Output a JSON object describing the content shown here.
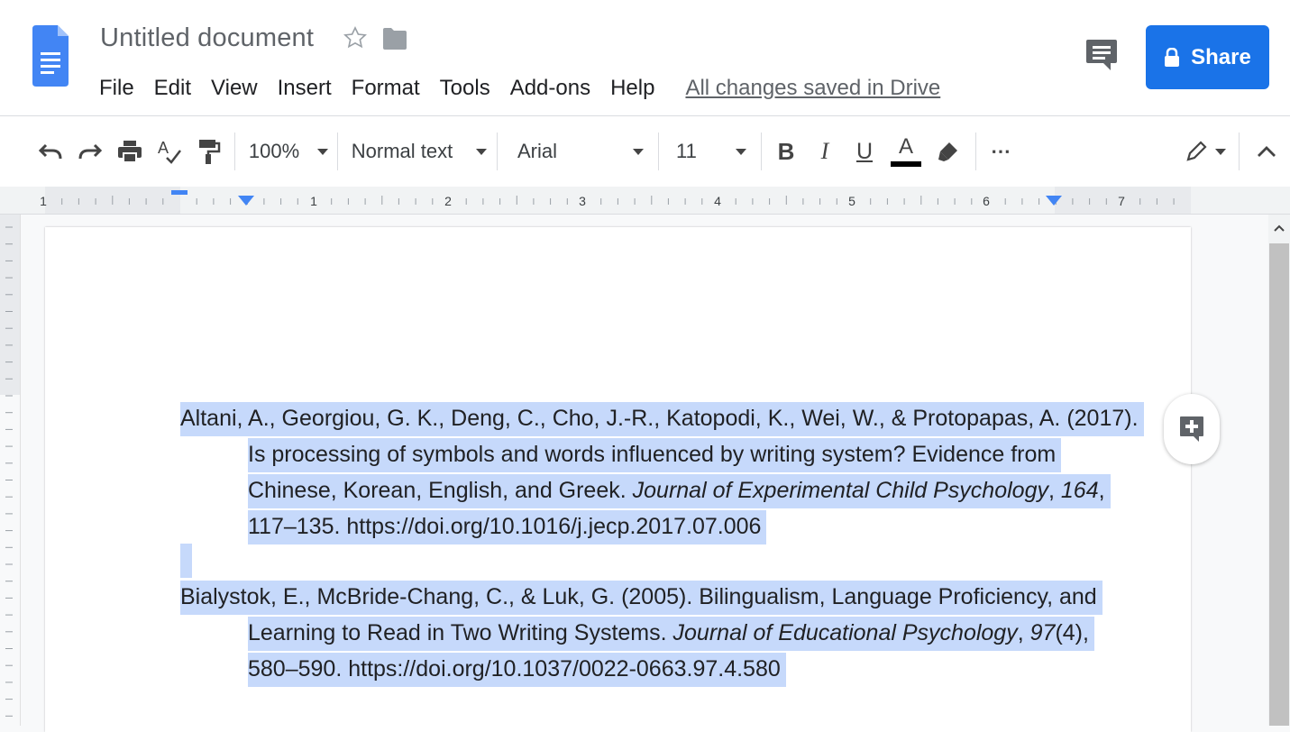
{
  "header": {
    "title": "Untitled document",
    "menu": [
      "File",
      "Edit",
      "View",
      "Insert",
      "Format",
      "Tools",
      "Add-ons",
      "Help"
    ],
    "saved_status": "All changes saved in Drive",
    "share_label": "Share",
    "icons": [
      "docs-logo-icon",
      "star-icon",
      "folder-icon",
      "comments-icon",
      "lock-icon"
    ],
    "colors": {
      "accent": "#1a73e8",
      "docs_blue": "#4285f4"
    }
  },
  "toolbar": {
    "zoom": "100%",
    "style": "Normal text",
    "font": "Arial",
    "font_size": "11",
    "bold": "B",
    "italic": "I",
    "underline": "U",
    "text_color": "A",
    "more": "⋯"
  },
  "ruler": {
    "labels": [
      "1",
      "1",
      "2",
      "3",
      "4",
      "5",
      "6",
      "7"
    ]
  },
  "document": {
    "selection_color": "#c6d9fb",
    "citations": [
      {
        "line1": "Altani, A., Georgiou, G. K., Deng, C., Cho, J.-R., Katopodi, K., Wei, W., & Protopapas, A. (2017).",
        "line2": "Is processing of symbols and words influenced by writing system? Evidence from",
        "line3_pre": "Chinese, Korean, English, and Greek. ",
        "line3_journal": "Journal of Experimental Child Psychology",
        "line3_sep": ", ",
        "line3_volume": "164",
        "line3_post": ",",
        "line4": "117–135. https://doi.org/10.1016/j.jecp.2017.07.006"
      },
      {
        "line1": "Bialystok, E., McBride-Chang, C., & Luk, G. (2005). Bilingualism, Language Proficiency, and",
        "line2_pre": "Learning to Read in Two Writing Systems. ",
        "line2_journal": "Journal of Educational Psychology",
        "line2_sep": ", ",
        "line2_volume": "97",
        "line2_post": "(4),",
        "line3": "580–590. https://doi.org/10.1037/0022-0663.97.4.580"
      }
    ]
  }
}
